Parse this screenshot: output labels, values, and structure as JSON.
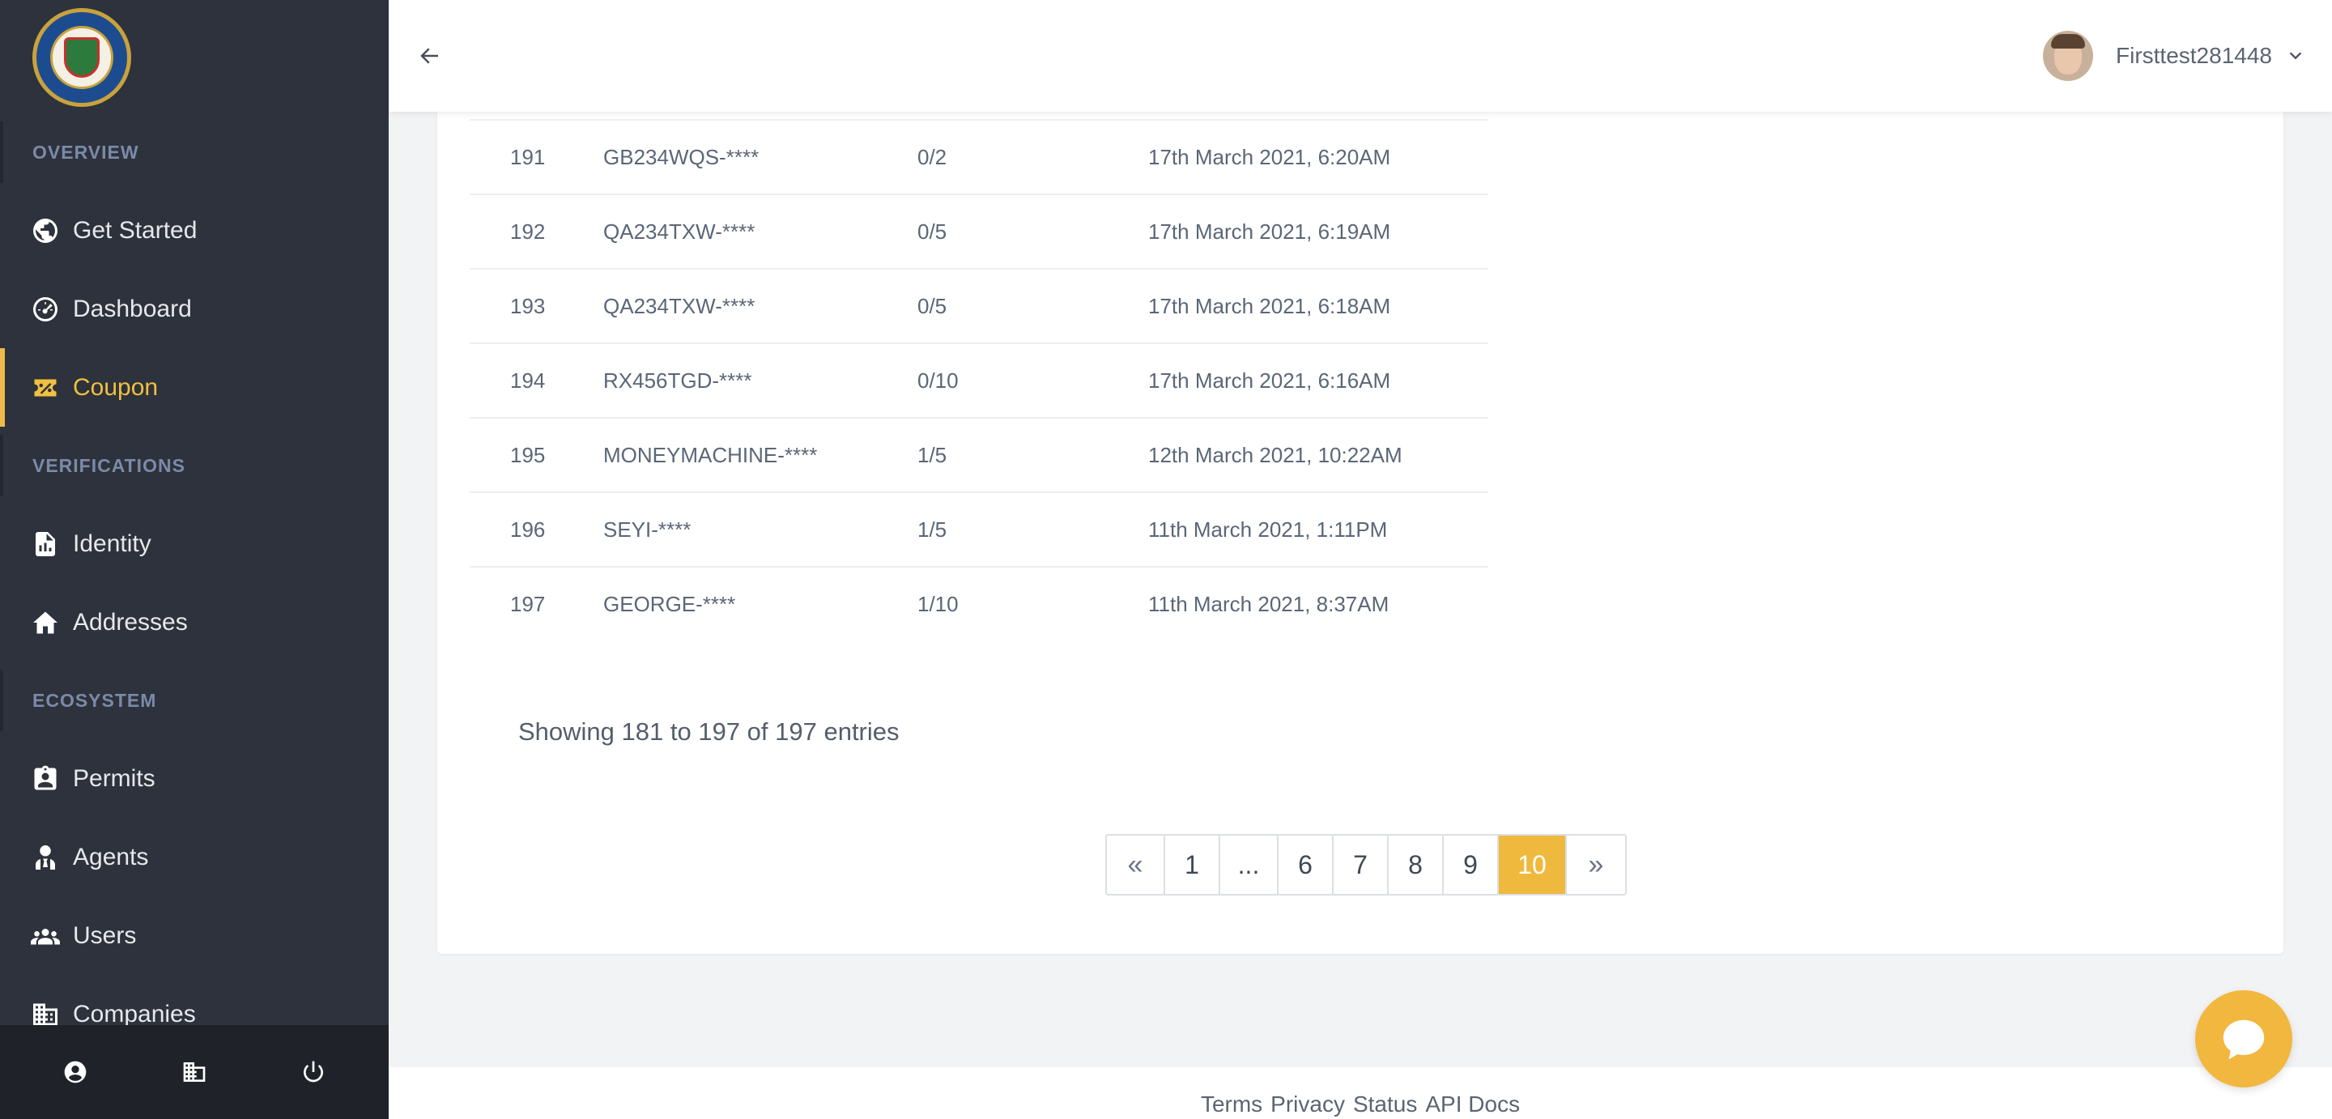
{
  "sidebar": {
    "logo_alt": "State gaming authority seal",
    "sections": [
      {
        "title": "OVERVIEW"
      },
      {
        "title": "VERIFICATIONS"
      },
      {
        "title": "ECOSYSTEM"
      }
    ],
    "items": [
      {
        "label": "Get Started",
        "icon": "globe-icon"
      },
      {
        "label": "Dashboard",
        "icon": "dashboard-gauge-icon"
      },
      {
        "label": "Coupon",
        "icon": "coupon-icon",
        "active": true
      },
      {
        "label": "Identity",
        "icon": "document-chart-icon"
      },
      {
        "label": "Addresses",
        "icon": "home-icon"
      },
      {
        "label": "Permits",
        "icon": "id-badge-icon"
      },
      {
        "label": "Agents",
        "icon": "agent-icon"
      },
      {
        "label": "Users",
        "icon": "users-icon"
      },
      {
        "label": "Companies",
        "icon": "building-icon"
      }
    ],
    "footer_icons": [
      "account-circle-icon",
      "building-icon",
      "power-icon"
    ]
  },
  "topbar": {
    "back_icon": "arrow-left-icon",
    "user_name": "Firsttest281448",
    "dropdown_icon": "chevron-down-icon"
  },
  "table": {
    "rows": [
      {
        "id": "191",
        "code": "GB234WQS-****",
        "usage": "0/2",
        "date": "17th March 2021, 6:20AM"
      },
      {
        "id": "192",
        "code": "QA234TXW-****",
        "usage": "0/5",
        "date": "17th March 2021, 6:19AM"
      },
      {
        "id": "193",
        "code": "QA234TXW-****",
        "usage": "0/5",
        "date": "17th March 2021, 6:18AM"
      },
      {
        "id": "194",
        "code": "RX456TGD-****",
        "usage": "0/10",
        "date": "17th March 2021, 6:16AM"
      },
      {
        "id": "195",
        "code": "MONEYMACHINE-****",
        "usage": "1/5",
        "date": "12th March 2021, 10:22AM"
      },
      {
        "id": "196",
        "code": "SEYI-****",
        "usage": "1/5",
        "date": "11th March 2021, 1:11PM"
      },
      {
        "id": "197",
        "code": "GEORGE-****",
        "usage": "1/10",
        "date": "11th March 2021, 8:37AM"
      }
    ]
  },
  "showing_text": "Showing 181 to 197 of 197 entries",
  "pagination": {
    "prev": "«",
    "pages": [
      "1",
      "...",
      "6",
      "7",
      "8",
      "9",
      "10"
    ],
    "active": "10",
    "next": "»"
  },
  "footer": {
    "links": [
      "Terms",
      "Privacy",
      "Status",
      "API Docs"
    ]
  },
  "colors": {
    "sidebar_bg": "#2d323c",
    "accent": "#efb93e",
    "section_title": "#7c8aa8"
  },
  "chat_icon": "chat-bubble-icon"
}
